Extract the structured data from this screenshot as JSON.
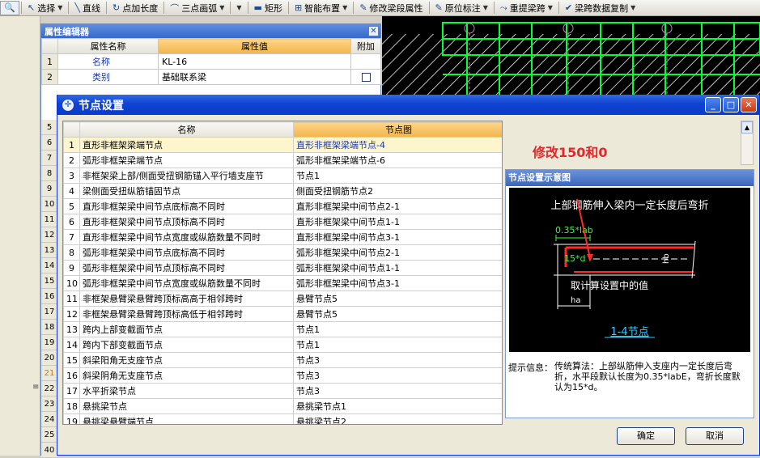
{
  "toolbar": {
    "items": [
      {
        "label": "选择",
        "icon": "cursor-icon",
        "glyph": "↖",
        "dropdown": true
      },
      {
        "label": "直线",
        "icon": "line-icon",
        "glyph": "╲",
        "dropdown": false
      },
      {
        "label": "点加长度",
        "icon": "point-length-icon",
        "glyph": "↻",
        "dropdown": false
      },
      {
        "label": "三点画弧",
        "icon": "arc-icon",
        "glyph": "⌒",
        "dropdown": true
      },
      {
        "label": "",
        "icon": "dropdown-icon",
        "glyph": "",
        "dropdown": true
      },
      {
        "label": "矩形",
        "icon": "rectangle-icon",
        "glyph": "▬",
        "dropdown": false
      },
      {
        "label": "智能布置",
        "icon": "smart-layout-icon",
        "glyph": "⊞",
        "dropdown": true
      },
      {
        "label": "修改梁段属性",
        "icon": "edit-beam-icon",
        "glyph": "✎",
        "dropdown": false
      },
      {
        "label": "原位标注",
        "icon": "annotate-icon",
        "glyph": "✎",
        "dropdown": true
      },
      {
        "label": "重提梁跨",
        "icon": "span-icon",
        "glyph": "⤳",
        "dropdown": true
      },
      {
        "label": "梁跨数据复制",
        "icon": "copy-icon",
        "glyph": "✔",
        "dropdown": true
      }
    ]
  },
  "property_editor": {
    "title": "属性编辑器",
    "columns": [
      "属性名称",
      "属性值",
      "附加"
    ],
    "rows": [
      {
        "num": "1",
        "name": "名称",
        "value": "KL-16",
        "checkbox": false
      },
      {
        "num": "2",
        "name": "类别",
        "value": "基础联系梁",
        "checkbox": true
      }
    ],
    "more_row_numbers": [
      "5",
      "6",
      "7",
      "8",
      "9",
      "10",
      "11",
      "12",
      "13",
      "14",
      "15",
      "16",
      "17",
      "18",
      "19",
      "20",
      "21",
      "22",
      "23",
      "24",
      "25",
      "40"
    ]
  },
  "dialog": {
    "title": "节点设置",
    "columns": [
      "名称",
      "节点图"
    ],
    "rows": [
      {
        "idx": "1",
        "name": "直形非框架梁端节点",
        "node": "直形非框架梁端节点-4"
      },
      {
        "idx": "2",
        "name": "弧形非框架梁端节点",
        "node": "弧形非框架梁端节点-6"
      },
      {
        "idx": "3",
        "name": "非框架梁上部/侧面受扭钢筋锚入平行墙支座节",
        "node": "节点1"
      },
      {
        "idx": "4",
        "name": "梁侧面受扭纵筋锚固节点",
        "node": "侧面受扭钢筋节点2"
      },
      {
        "idx": "5",
        "name": "直形非框架梁中间节点底标高不同时",
        "node": "直形非框架梁中间节点2-1"
      },
      {
        "idx": "6",
        "name": "直形非框架梁中间节点顶标高不同时",
        "node": "直形非框架梁中间节点1-1"
      },
      {
        "idx": "7",
        "name": "直形非框架梁中间节点宽度或纵筋数量不同时",
        "node": "直形非框架梁中间节点3-1"
      },
      {
        "idx": "8",
        "name": "弧形非框架梁中间节点底标高不同时",
        "node": "弧形非框架梁中间节点2-1"
      },
      {
        "idx": "9",
        "name": "弧形非框架梁中间节点顶标高不同时",
        "node": "弧形非框架梁中间节点1-1"
      },
      {
        "idx": "10",
        "name": "弧形非框架梁中间节点宽度或纵筋数量不同时",
        "node": "弧形非框架梁中间节点3-1"
      },
      {
        "idx": "11",
        "name": "非框架悬臂梁悬臂跨顶标高高于相邻跨时",
        "node": "悬臂节点5"
      },
      {
        "idx": "12",
        "name": "非框架悬臂梁悬臂跨顶标高低于相邻跨时",
        "node": "悬臂节点5"
      },
      {
        "idx": "13",
        "name": "跨内上部变截面节点",
        "node": "节点1"
      },
      {
        "idx": "14",
        "name": "跨内下部变截面节点",
        "node": "节点1"
      },
      {
        "idx": "15",
        "name": "斜梁阳角无支座节点",
        "node": "节点3"
      },
      {
        "idx": "16",
        "name": "斜梁阴角无支座节点",
        "node": "节点3"
      },
      {
        "idx": "17",
        "name": "水平折梁节点",
        "node": "节点3"
      },
      {
        "idx": "18",
        "name": "悬挑梁节点",
        "node": "悬挑梁节点1"
      },
      {
        "idx": "19",
        "name": "悬挑梁悬臂端节点",
        "node": "悬挑梁节点2"
      }
    ],
    "annotation": "修改150和0",
    "preview": {
      "title": "节点设置示意图",
      "caption": "上部钢筋伸入梁内一定长度后弯折",
      "label_035lab": "0.35*lab",
      "label_15d": "15*d",
      "label_hb": "hb",
      "label_ha": "ha",
      "label_calc": "取计算设置中的值",
      "node_link": "1-4节点"
    },
    "hint_label": "提示信息：",
    "hint_text": "传统算法：上部纵筋伸入支座内一定长度后弯折，水平段默认长度为0.35*labE，弯折长度默认为15*d。",
    "ok_label": "确定",
    "cancel_label": "取消"
  }
}
